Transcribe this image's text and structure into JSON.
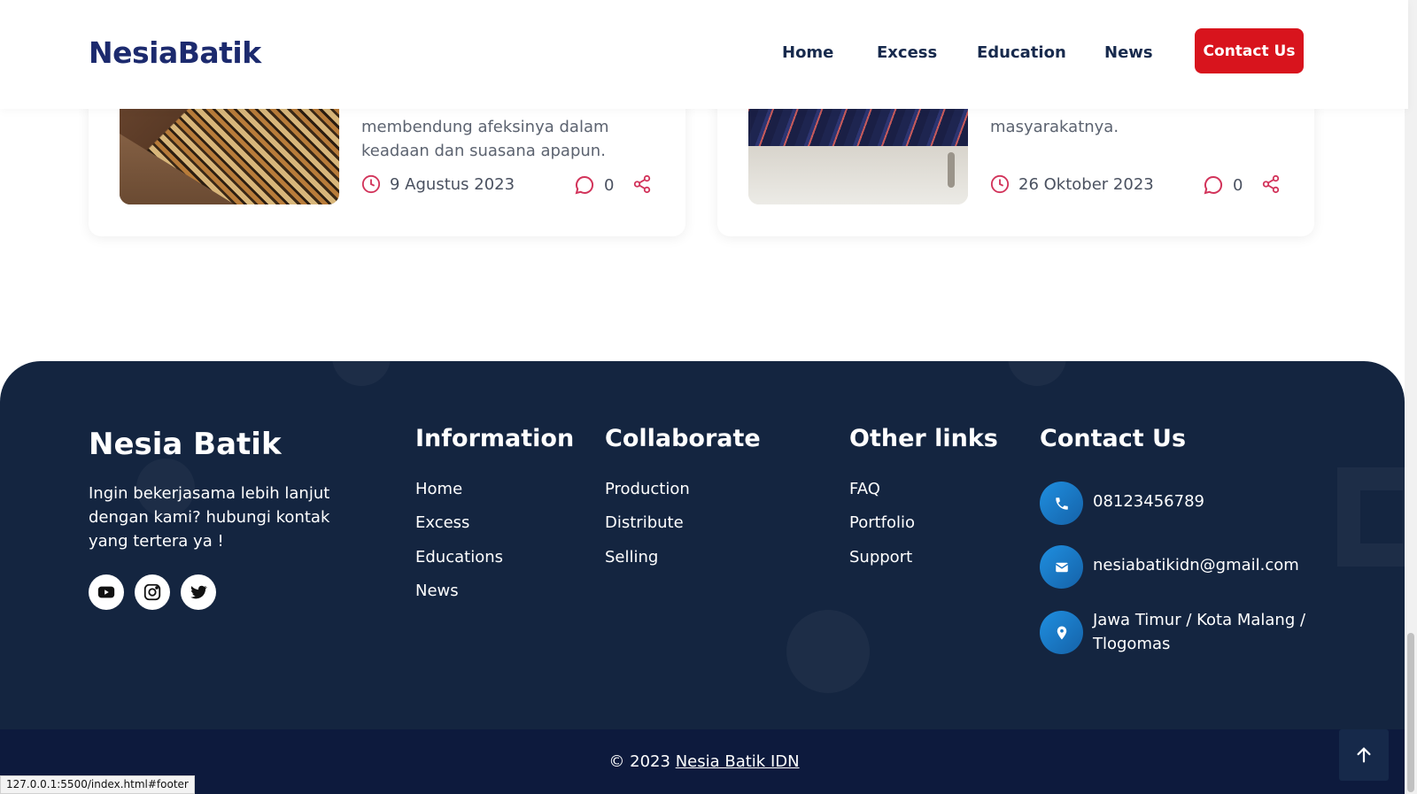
{
  "header": {
    "logo": "NesiaBatik",
    "nav": [
      "Home",
      "Excess",
      "Education",
      "News"
    ],
    "contact_button": "Contact Us"
  },
  "cards": [
    {
      "excerpt_line1": "membendung afeksinya dalam",
      "excerpt_line2": "keadaan dan suasana apapun.",
      "date": "9 Agustus 2023",
      "comments": "0"
    },
    {
      "excerpt_line1": "masyarakatnya.",
      "excerpt_line2": "",
      "date": "26 Oktober 2023",
      "comments": "0"
    }
  ],
  "footer": {
    "brand": "Nesia Batik",
    "description": "Ingin bekerjasama lebih lanjut dengan kami? hubungi kontak yang tertera ya !",
    "social_icons": [
      "youtube-icon",
      "instagram-icon",
      "twitter-icon"
    ],
    "information": {
      "title": "Information",
      "links": [
        "Home",
        "Excess",
        "Educations",
        "News"
      ]
    },
    "collaborate": {
      "title": "Collaborate",
      "links": [
        "Production",
        "Distribute",
        "Selling"
      ]
    },
    "other_links": {
      "title": "Other links",
      "links": [
        "FAQ",
        "Portfolio",
        "Support"
      ]
    },
    "contact": {
      "title": "Contact Us",
      "phone": "08123456789",
      "email": "nesiabatikidn@gmail.com",
      "address": "Jawa Timur / Kota Malang / Tlogomas"
    },
    "copyright_prefix": "© 2023",
    "copyright_link": "Nesia Batik IDN"
  },
  "status_bar": {
    "url": "127.0.0.1:5500/index.html#footer"
  },
  "colors": {
    "brand_navy": "#1c2a6e",
    "accent_red": "#d8141d",
    "footer_bg": "#142540",
    "icon_pink": "#d2335a"
  }
}
